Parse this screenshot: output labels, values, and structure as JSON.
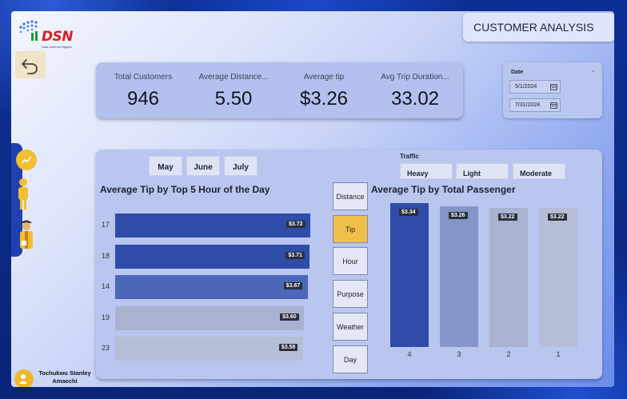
{
  "brand": {
    "logo_text": "DSN",
    "logo_sub": "Data Science Nigeria"
  },
  "header": {
    "title": "CUSTOMER ANALYSIS"
  },
  "kpis": [
    {
      "label": "Total Customers",
      "value": "946"
    },
    {
      "label": "Average Distance...",
      "value": "5.50"
    },
    {
      "label": "Average tip",
      "value": "$3.26"
    },
    {
      "label": "Avg Trip Duration...",
      "value": "33.02"
    }
  ],
  "date_filter": {
    "title": "Date",
    "start": "5/1/2024",
    "end": "7/31/2024"
  },
  "months": [
    "May",
    "June",
    "July"
  ],
  "traffic": {
    "label": "Traffic",
    "options": [
      "Heavy",
      "Light",
      "Moderate"
    ]
  },
  "slicers": [
    "Distance",
    "Tip",
    "Hour",
    "Purpose",
    "Weather",
    "Day"
  ],
  "active_slicer": "Tip",
  "user": {
    "name": "Tochukwu Stanley Amaechi"
  },
  "colors": {
    "bar_dark": "#2f4da8",
    "bar_mid": "#4c66b8",
    "bar_light": "#a9b3cf",
    "bar_pale": "#b6bdd6",
    "accent": "#f0c04a"
  },
  "chart_data": [
    {
      "type": "bar",
      "orientation": "horizontal",
      "title": "Average Tip by Top 5 Hour of the Day",
      "categories": [
        "17",
        "18",
        "14",
        "19",
        "23"
      ],
      "values": [
        3.72,
        3.71,
        3.67,
        3.6,
        3.58
      ],
      "labels": [
        "$3.72",
        "$3.71",
        "$3.67",
        "$3.60",
        "$3.58"
      ]
    },
    {
      "type": "bar",
      "orientation": "vertical",
      "title": "Average Tip by Total Passenger",
      "categories": [
        "4",
        "3",
        "2",
        "1"
      ],
      "values": [
        3.34,
        3.26,
        3.22,
        3.22
      ],
      "labels": [
        "$3.34",
        "$3.26",
        "$3.22",
        "$3.22"
      ]
    }
  ]
}
